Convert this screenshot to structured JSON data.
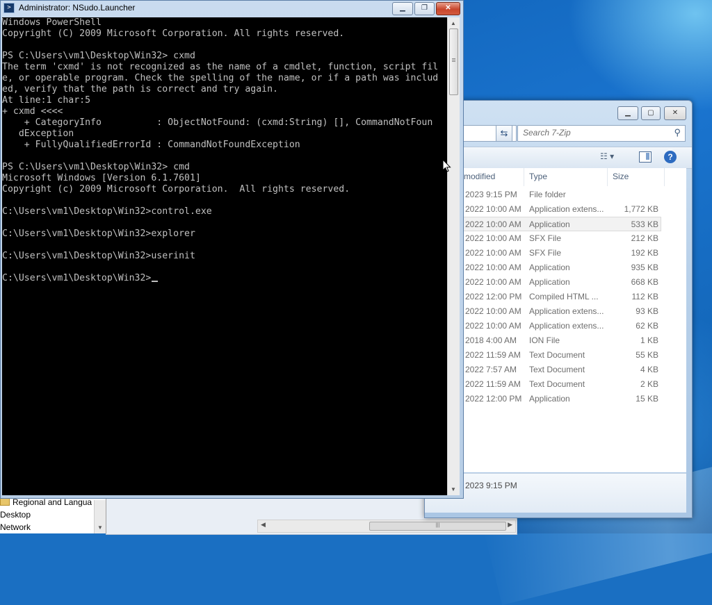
{
  "console": {
    "title": "Administrator: NSudo.Launcher",
    "lines": [
      "Windows PowerShell",
      "Copyright (C) 2009 Microsoft Corporation. All rights reserved.",
      "",
      "PS C:\\Users\\vm1\\Desktop\\Win32> cxmd",
      "The term 'cxmd' is not recognized as the name of a cmdlet, function, script fil",
      "e, or operable program. Check the spelling of the name, or if a path was includ",
      "ed, verify that the path is correct and try again.",
      "At line:1 char:5",
      "+ cxmd <<<<",
      "    + CategoryInfo          : ObjectNotFound: (cxmd:String) [], CommandNotFoun",
      "   dException",
      "    + FullyQualifiedErrorId : CommandNotFoundException",
      "",
      "PS C:\\Users\\vm1\\Desktop\\Win32> cmd",
      "Microsoft Windows [Version 6.1.7601]",
      "Copyright (c) 2009 Microsoft Corporation.  All rights reserved.",
      "",
      "C:\\Users\\vm1\\Desktop\\Win32>control.exe",
      "",
      "C:\\Users\\vm1\\Desktop\\Win32>explorer",
      "",
      "C:\\Users\\vm1\\Desktop\\Win32>userinit",
      "",
      "C:\\Users\\vm1\\Desktop\\Win32>"
    ],
    "buttons": {
      "minimize": "▁",
      "restore": "❐",
      "close": "✕"
    }
  },
  "explorer": {
    "search_placeholder": "Search 7-Zip",
    "columns": {
      "modified": "modified",
      "type": "Type",
      "size": "Size"
    },
    "rows": [
      {
        "date": "2023 9:15 PM",
        "type": "File folder",
        "size": ""
      },
      {
        "date": "2022 10:00 AM",
        "type": "Application extens...",
        "size": "1,772 KB"
      },
      {
        "date": "2022 10:00 AM",
        "type": "Application",
        "size": "533 KB"
      },
      {
        "date": "2022 10:00 AM",
        "type": "SFX File",
        "size": "212 KB"
      },
      {
        "date": "2022 10:00 AM",
        "type": "SFX File",
        "size": "192 KB"
      },
      {
        "date": "2022 10:00 AM",
        "type": "Application",
        "size": "935 KB"
      },
      {
        "date": "2022 10:00 AM",
        "type": "Application",
        "size": "668 KB"
      },
      {
        "date": "2022 12:00 PM",
        "type": "Compiled HTML ...",
        "size": "112 KB"
      },
      {
        "date": "2022 10:00 AM",
        "type": "Application extens...",
        "size": "93 KB"
      },
      {
        "date": "2022 10:00 AM",
        "type": "Application extens...",
        "size": "62 KB"
      },
      {
        "date": "2018 4:00 AM",
        "type": "ION File",
        "size": "1 KB"
      },
      {
        "date": "2022 11:59 AM",
        "type": "Text Document",
        "size": "55 KB"
      },
      {
        "date": "2022 7:57 AM",
        "type": "Text Document",
        "size": "4 KB"
      },
      {
        "date": "2022 11:59 AM",
        "type": "Text Document",
        "size": "2 KB"
      },
      {
        "date": "2022 12:00 PM",
        "type": "Application",
        "size": "15 KB"
      }
    ],
    "selected_row": 2,
    "details_text": "2023 9:15 PM"
  },
  "background_window": {
    "items": [
      "Regional and Langua",
      "Desktop",
      "Network"
    ]
  },
  "colors": {
    "console_bg": "#000000",
    "console_fg": "#c0c0c0",
    "close_button": "#c8462c"
  }
}
